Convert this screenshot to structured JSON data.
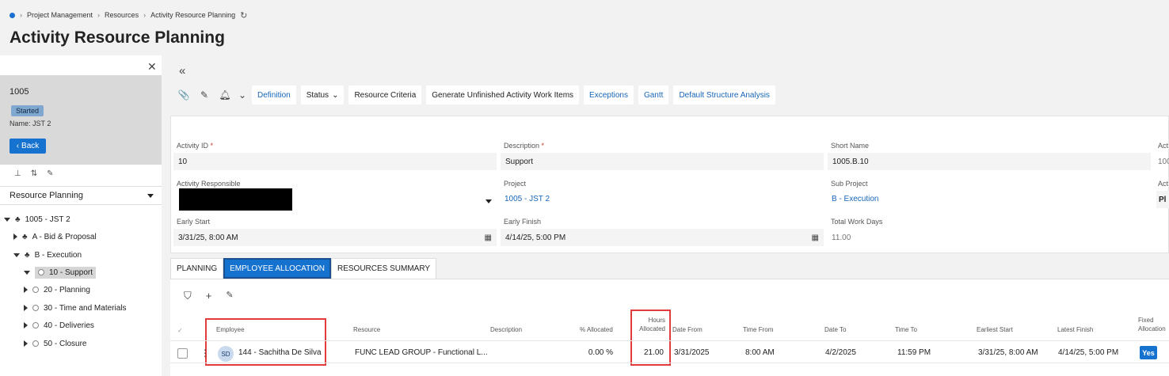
{
  "breadcrumb": {
    "items": [
      "Project Management",
      "Resources",
      "Activity Resource Planning"
    ]
  },
  "page_title": "Activity Resource Planning",
  "left_panel": {
    "project_number": "1005",
    "status": "Started",
    "name_label": "Name:",
    "name_value": "JST 2",
    "back_label": "Back",
    "nav_selector": "Resource Planning",
    "tree": [
      {
        "label": "1005 - JST 2"
      },
      {
        "label": "A - Bid & Proposal"
      },
      {
        "label": "B - Execution"
      },
      {
        "label": "10 - Support"
      },
      {
        "label": "20 - Planning"
      },
      {
        "label": "30 - Time and Materials"
      },
      {
        "label": "40 - Deliveries"
      },
      {
        "label": "50 - Closure"
      }
    ]
  },
  "toolbar": {
    "definition": "Definition",
    "status": "Status",
    "resource_criteria": "Resource Criteria",
    "generate": "Generate Unfinished Activity Work Items",
    "exceptions": "Exceptions",
    "gantt": "Gantt",
    "default_structure": "Default Structure Analysis"
  },
  "form": {
    "activity_id_label": "Activity ID",
    "activity_id": "10",
    "description_label": "Description",
    "description": "Support",
    "short_name_label": "Short Name",
    "short_name": "1005.B.10",
    "col4_label_partial": "Act",
    "col4_value_partial": "100",
    "activity_responsible_label": "Activity Responsible",
    "project_label": "Project",
    "project": "1005 - JST 2",
    "sub_project_label": "Sub Project",
    "sub_project": "B - Execution",
    "col4_row2_label_partial": "Act",
    "col4_row2_value_partial": "Pl",
    "early_start_label": "Early Start",
    "early_start": "3/31/25, 8:00 AM",
    "early_finish_label": "Early Finish",
    "early_finish": "4/14/25, 5:00 PM",
    "total_work_days_label": "Total Work Days",
    "total_work_days": "11.00"
  },
  "tabs": [
    "PLANNING",
    "EMPLOYEE ALLOCATION",
    "RESOURCES SUMMARY"
  ],
  "grid": {
    "headers": {
      "employee": "Employee",
      "resource": "Resource",
      "description": "Description",
      "pct_allocated": "% Allocated",
      "hours_allocated_1": "Hours",
      "hours_allocated_2": "Allocated",
      "date_from": "Date From",
      "time_from": "Time From",
      "date_to": "Date To",
      "time_to": "Time To",
      "earliest_start": "Earliest Start",
      "latest_finish": "Latest Finish",
      "fixed_allocation_1": "Fixed",
      "fixed_allocation_2": "Allocation"
    },
    "rows": [
      {
        "avatar": "SD",
        "employee": "144 - Sachitha De Silva",
        "resource": "FUNC LEAD GROUP - Functional L...",
        "description": "",
        "pct_allocated": "0.00 %",
        "hours_allocated": "21.00",
        "date_from": "3/31/2025",
        "time_from": "8:00 AM",
        "date_to": "4/2/2025",
        "time_to": "11:59 PM",
        "earliest_start": "3/31/25, 8:00 AM",
        "latest_finish": "4/14/25, 5:00 PM",
        "fixed_allocation": "Yes"
      }
    ]
  },
  "colors": {
    "accent": "#1672cf",
    "highlight": "#e23b3b",
    "link": "#1766b8"
  }
}
